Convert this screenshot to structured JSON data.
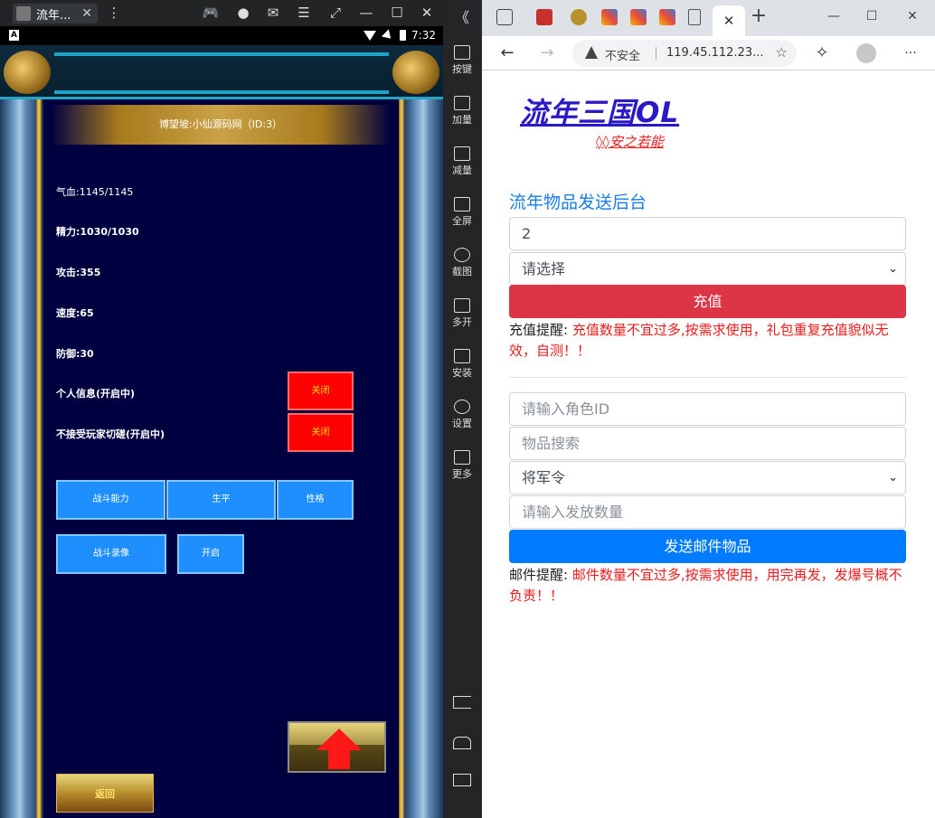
{
  "emulator": {
    "tab_title": "流年...",
    "tab_close": "✕",
    "android_badge": "A",
    "clock": "7:32",
    "sidebar": [
      {
        "label": "按键",
        "name": "keyboard-icon"
      },
      {
        "label": "加量",
        "name": "volume-up-icon"
      },
      {
        "label": "减量",
        "name": "volume-down-icon"
      },
      {
        "label": "全屏",
        "name": "fullscreen-icon"
      },
      {
        "label": "截图",
        "name": "scissors-icon"
      },
      {
        "label": "多开",
        "name": "multi-instance-icon"
      },
      {
        "label": "安装",
        "name": "apk-install-icon"
      },
      {
        "label": "设置",
        "name": "gear-icon"
      },
      {
        "label": "更多",
        "name": "more-icon"
      }
    ],
    "collapse_glyph": "《"
  },
  "game": {
    "title": "博望坡:小仙源码网（ID:3）",
    "stats": {
      "hp": "气血:1145/1145",
      "energy": "精力:1030/1030",
      "attack": "攻击:355",
      "speed": "速度:65",
      "defense": "防御:30",
      "personal_info": "个人信息(开启中)",
      "no_duel": "不接受玩家切磋(开启中)"
    },
    "close_label": "关闭",
    "tabs": [
      "战斗能力",
      "生平",
      "性格"
    ],
    "battle_replay": "战斗录像",
    "open_label": "开启",
    "back_label": "返回"
  },
  "browser": {
    "insecure_label": "不安全",
    "url": "119.45.112.23...",
    "new_tab": "+",
    "tab_close": "✕",
    "back": "←",
    "forward": "→",
    "menu": "···",
    "min": "—",
    "max": "☐",
    "close": "✕"
  },
  "page": {
    "logo": "流年三国OL",
    "sublogo": "◊◊安之若能",
    "heading": "流年物品发送后台",
    "recharge": {
      "input_value": "2",
      "select_value": "请选择",
      "button": "充值",
      "note_label": "充值提醒: ",
      "note_text": "充值数量不宜过多,按需求使用，礼包重复充值貌似无效，自测！！"
    },
    "mail": {
      "role_id_placeholder": "请输入角色ID",
      "item_search_placeholder": "物品搜索",
      "item_select_value": "将军令",
      "quantity_placeholder": "请输入发放数量",
      "button": "发送邮件物品",
      "note_label": "邮件提醒: ",
      "note_text": "邮件数量不宜过多,按需求使用，用完再发，发爆号概不负责！！"
    },
    "colors": {
      "heading": "#1b7ee6",
      "logo": "#2a19c6",
      "danger": "#dc3545",
      "primary": "#007bff",
      "note_red": "#e61c1c"
    }
  }
}
